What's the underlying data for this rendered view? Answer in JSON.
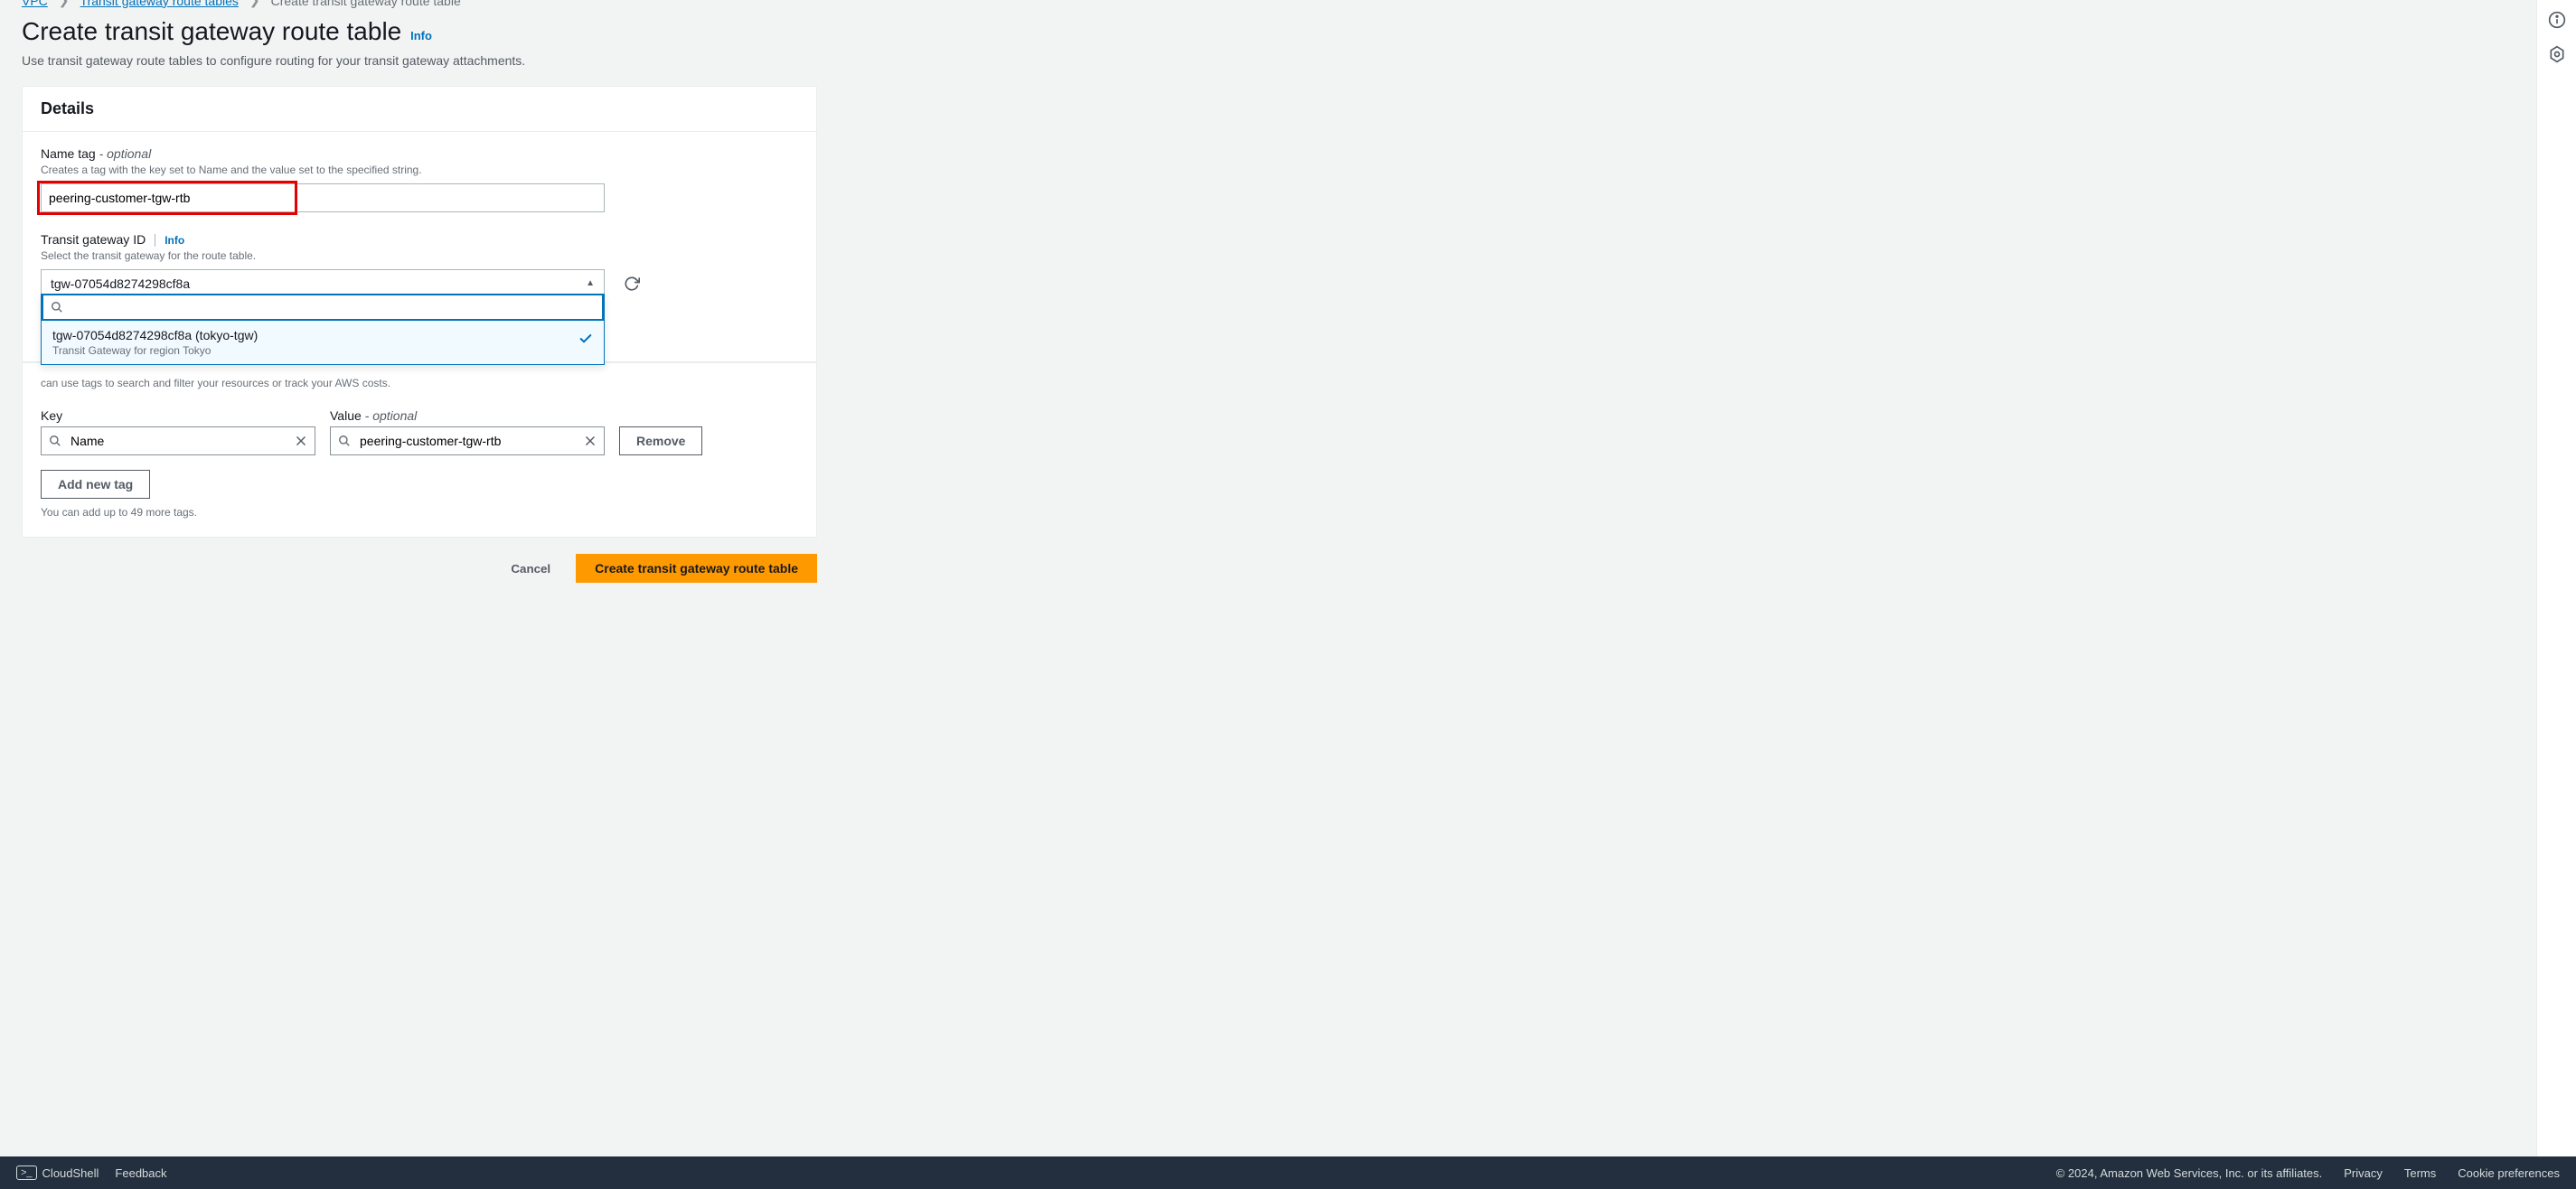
{
  "breadcrumbs": {
    "vpc": "VPC",
    "rtables": "Transit gateway route tables",
    "current": "Create transit gateway route table"
  },
  "header": {
    "title": "Create transit gateway route table",
    "info": "Info",
    "subtitle": "Use transit gateway route tables to configure routing for your transit gateway attachments."
  },
  "details": {
    "panel_title": "Details",
    "name_label": "Name tag",
    "name_optional": " - optional",
    "name_help": "Creates a tag with the key set to Name and the value set to the specified string.",
    "name_value": "peering-customer-tgw-rtb",
    "tgw_label": "Transit gateway ID",
    "tgw_info": "Info",
    "tgw_help": "Select the transit gateway for the route table.",
    "tgw_selected": "tgw-07054d8274298cf8a",
    "dropdown": {
      "search_value": "",
      "option_label": "tgw-07054d8274298cf8a (tokyo-tgw)",
      "option_desc": "Transit Gateway for region Tokyo"
    }
  },
  "tags": {
    "panel_desc_tail": "can use tags to search and filter your resources or track your AWS costs.",
    "key_header": "Key",
    "value_header": "Value",
    "value_optional": " - optional",
    "key_value": "Name",
    "value_value": "peering-customer-tgw-rtb",
    "remove": "Remove",
    "add_new": "Add new tag",
    "limit_text": "You can add up to 49 more tags."
  },
  "actions": {
    "cancel": "Cancel",
    "create": "Create transit gateway route table"
  },
  "footer": {
    "cloudshell": "CloudShell",
    "feedback": "Feedback",
    "copyright": "© 2024, Amazon Web Services, Inc. or its affiliates.",
    "privacy": "Privacy",
    "terms": "Terms",
    "cookie": "Cookie preferences"
  }
}
